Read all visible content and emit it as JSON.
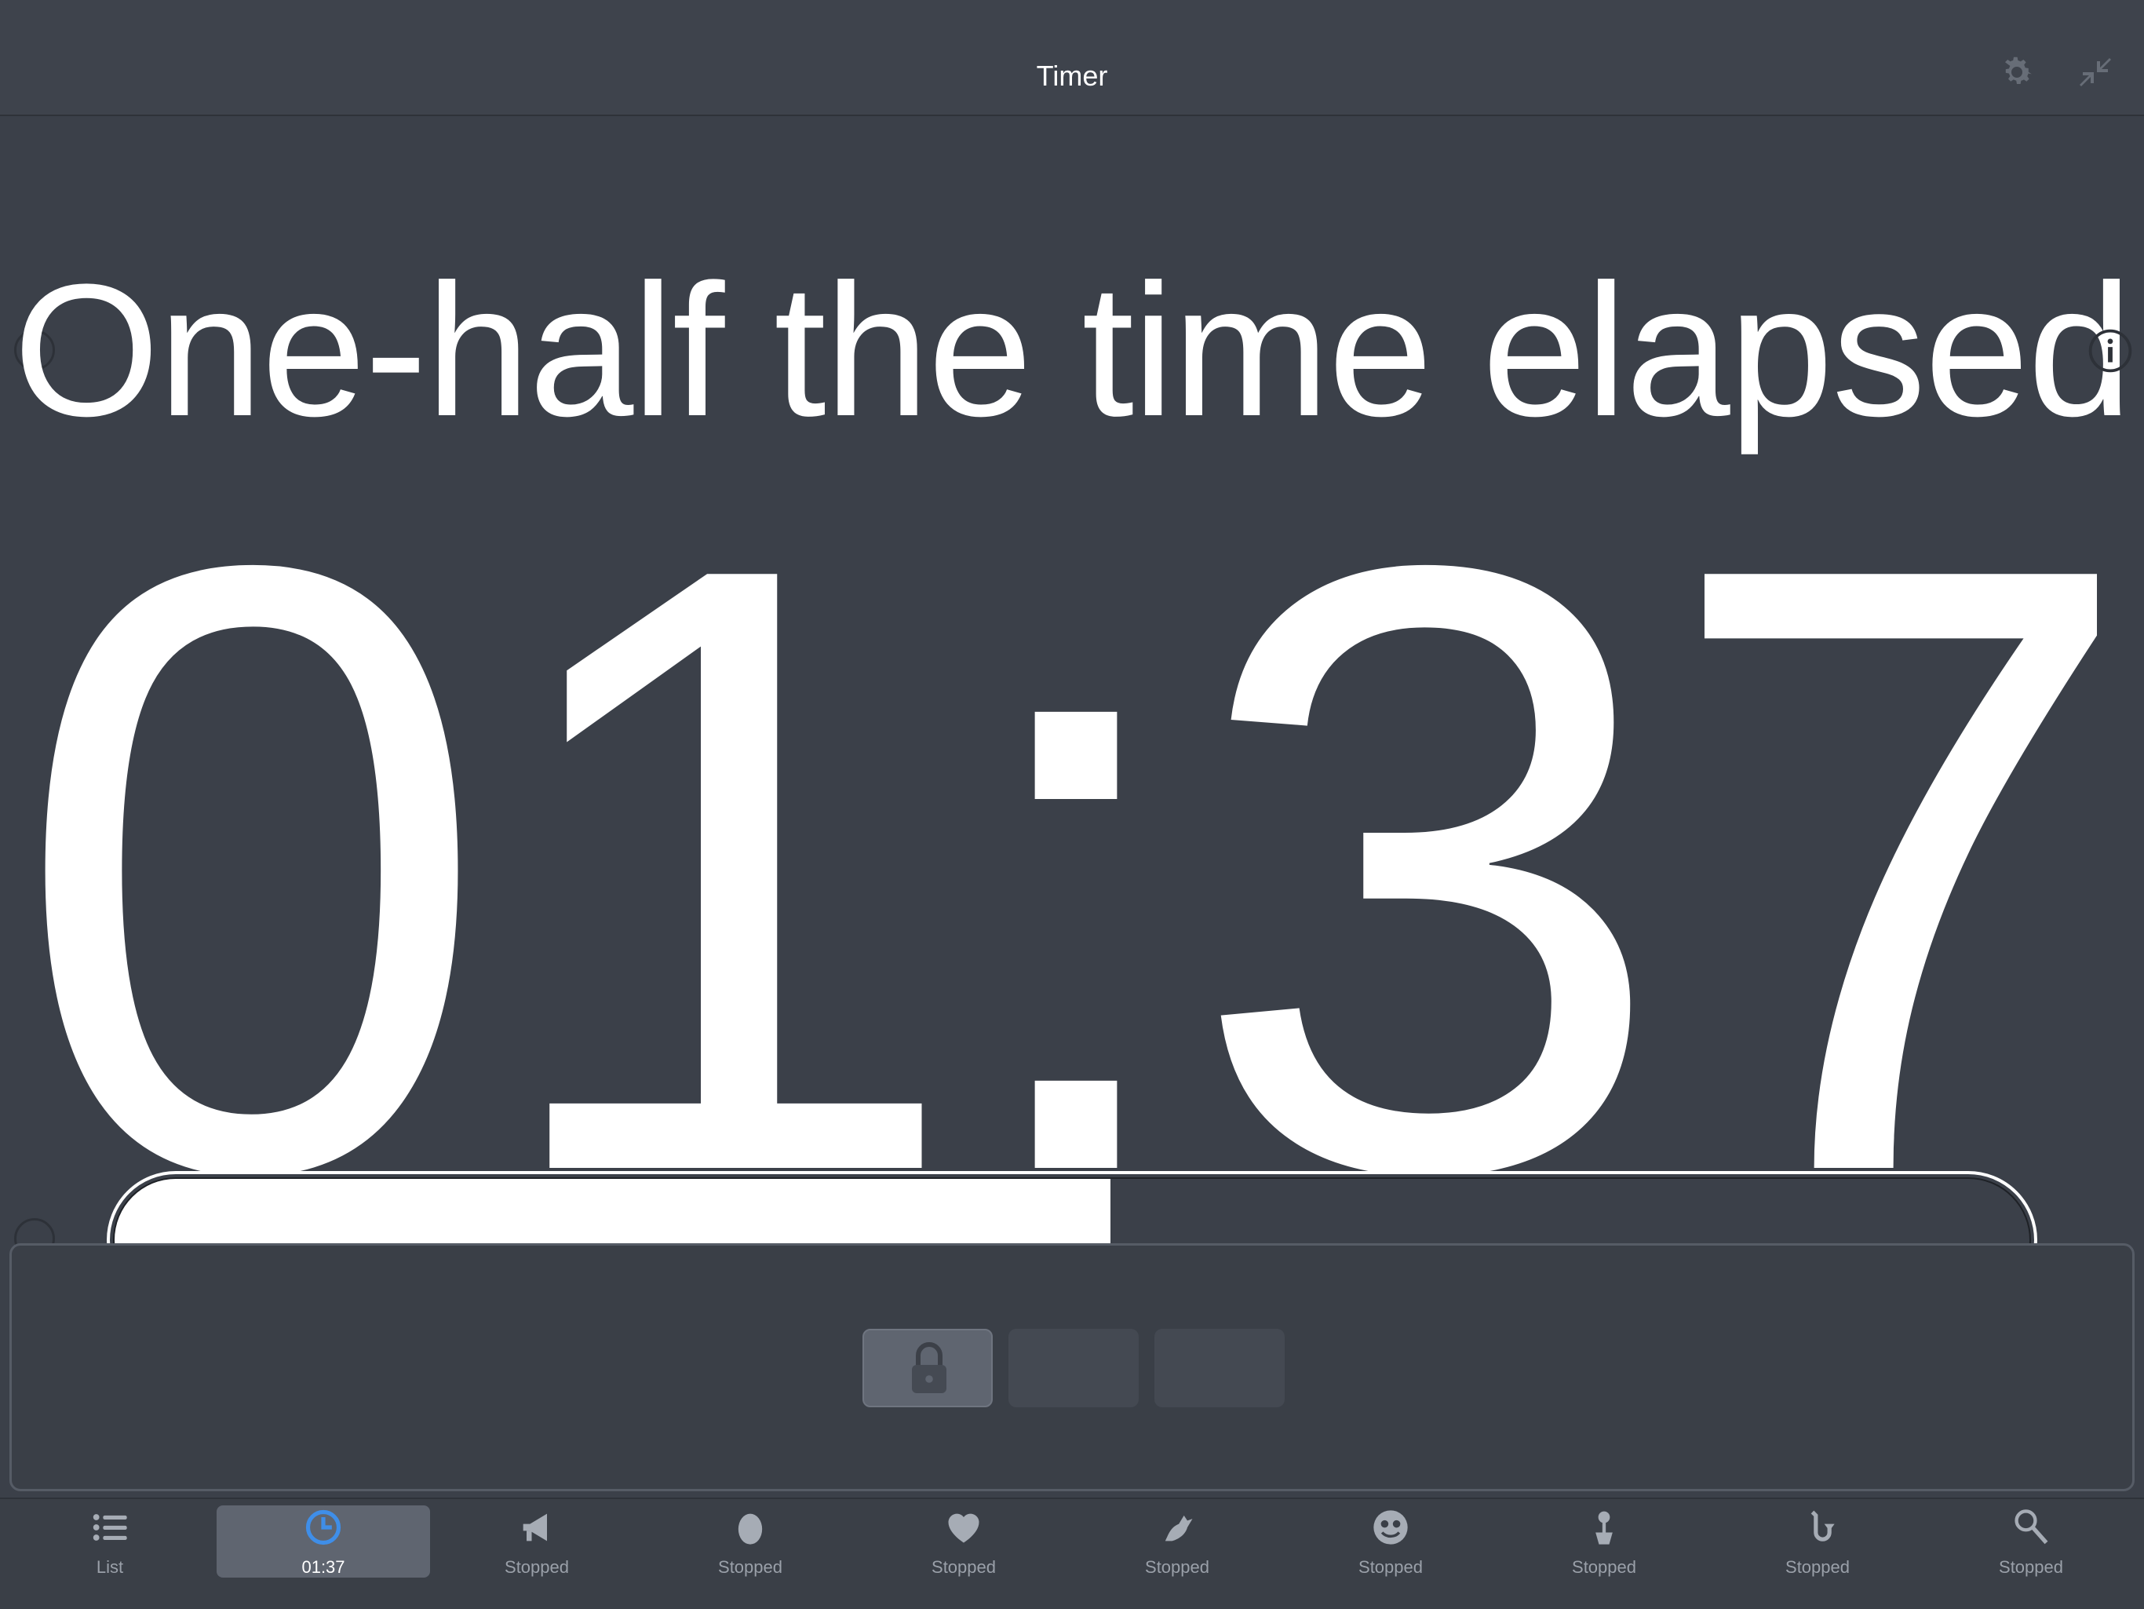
{
  "header": {
    "title": "Timer",
    "icons": [
      "gear-icon",
      "shrink-icon"
    ]
  },
  "main": {
    "message": "One-half the time elapsed",
    "time": "01:37",
    "progress_fraction": 0.52
  },
  "controls": {
    "buttons": [
      "lock-icon",
      "empty",
      "empty"
    ]
  },
  "tabs": [
    {
      "label": "List",
      "icon": "list-icon",
      "selected": false
    },
    {
      "label": "01:37",
      "icon": "timer-icon",
      "selected": true
    },
    {
      "label": "Stopped",
      "icon": "megaphone-icon",
      "selected": false
    },
    {
      "label": "Stopped",
      "icon": "egg-icon",
      "selected": false
    },
    {
      "label": "Stopped",
      "icon": "heart-icon",
      "selected": false
    },
    {
      "label": "Stopped",
      "icon": "dragon-icon",
      "selected": false
    },
    {
      "label": "Stopped",
      "icon": "smiley-icon",
      "selected": false
    },
    {
      "label": "Stopped",
      "icon": "flower-pot-icon",
      "selected": false
    },
    {
      "label": "Stopped",
      "icon": "saxophone-icon",
      "selected": false
    },
    {
      "label": "Stopped",
      "icon": "tennis-racket-icon",
      "selected": false
    }
  ],
  "colors": {
    "background": "#3b4049",
    "accent": "#3f8ee8",
    "text": "#ffffff"
  }
}
